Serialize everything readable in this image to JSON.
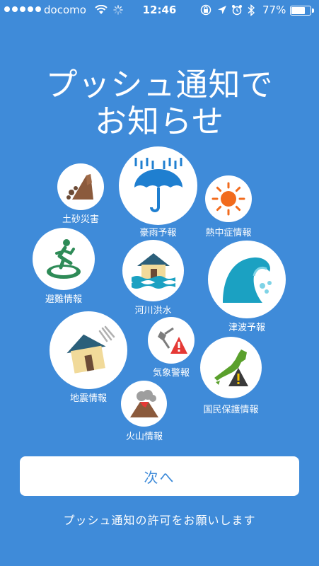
{
  "status_bar": {
    "carrier": "docomo",
    "time": "12:46",
    "battery_percent": "77%",
    "battery_level": 0.77,
    "icons": [
      "signal-dots-icon",
      "wifi-icon",
      "activity-spinner-icon",
      "screen-lock-icon",
      "location-arrow-icon",
      "alarm-icon",
      "bluetooth-icon",
      "battery-icon"
    ]
  },
  "title": {
    "line1": "プッシュ通知で",
    "line2": "お知らせ"
  },
  "categories": [
    {
      "label": "土砂災害",
      "icon": "landslide-icon"
    },
    {
      "label": "豪雨予報",
      "icon": "umbrella-rain-icon"
    },
    {
      "label": "熱中症情報",
      "icon": "sun-icon"
    },
    {
      "label": "避難情報",
      "icon": "evacuation-runner-icon"
    },
    {
      "label": "河川洪水",
      "icon": "flood-house-icon"
    },
    {
      "label": "津波予報",
      "icon": "tsunami-wave-icon"
    },
    {
      "label": "地震情報",
      "icon": "earthquake-house-icon"
    },
    {
      "label": "気象警報",
      "icon": "weather-warning-icon"
    },
    {
      "label": "国民保護情報",
      "icon": "japan-map-warning-icon"
    },
    {
      "label": "火山情報",
      "icon": "volcano-icon"
    }
  ],
  "next_button": {
    "label": "次へ"
  },
  "footer_note": "プッシュ通知の許可をお願いします",
  "colors": {
    "background": "#3f8bd9",
    "accent_blue": "#3f8bd9",
    "warning_red": "#e53935",
    "sun_orange": "#f26b1d",
    "tsunami_teal": "#1ba1c2",
    "green": "#2e8b57"
  }
}
